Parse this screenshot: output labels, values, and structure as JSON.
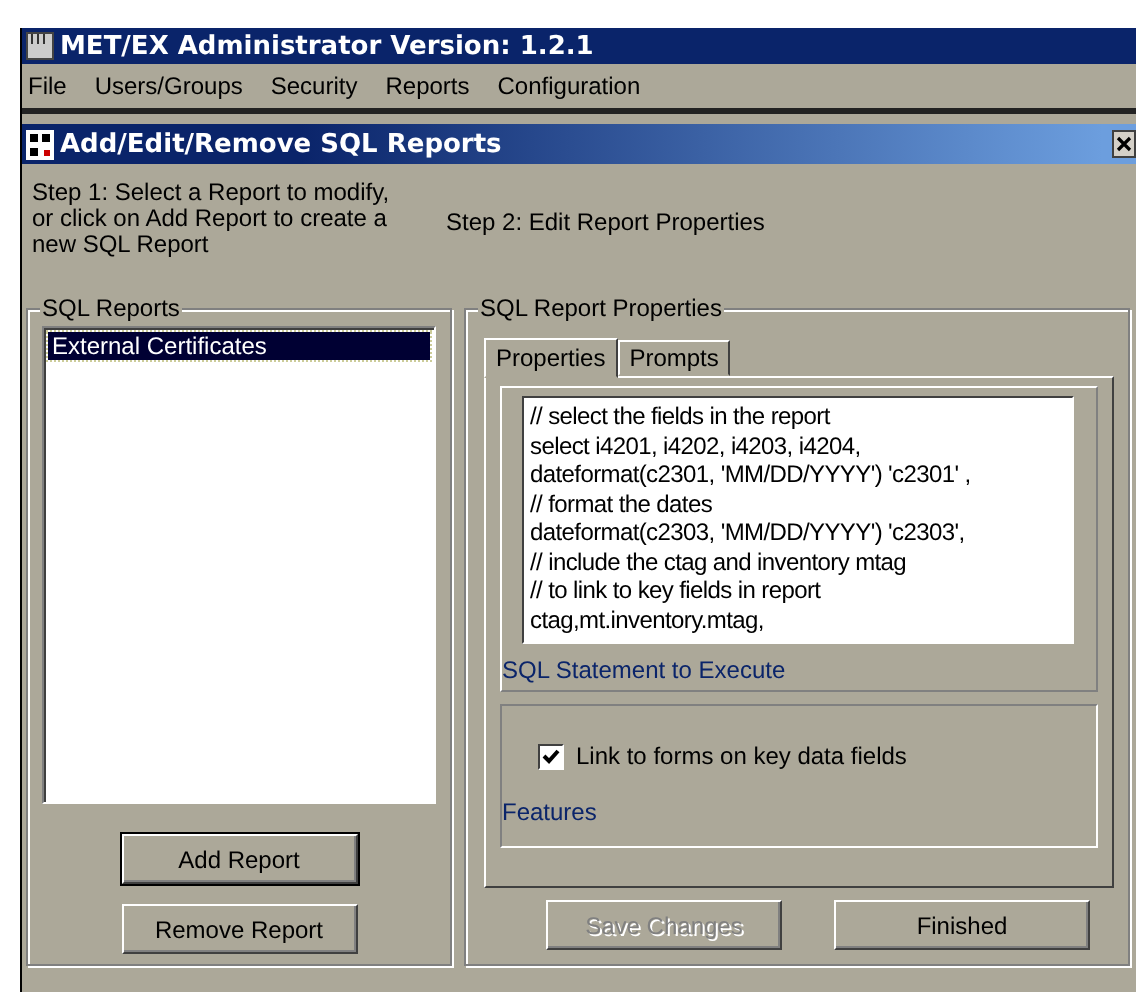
{
  "window": {
    "title": "MET/EX Administrator Version: 1.2.1"
  },
  "menu": [
    {
      "label": "File"
    },
    {
      "label": "Users/Groups"
    },
    {
      "label": "Security"
    },
    {
      "label": "Reports"
    },
    {
      "label": "Configuration"
    }
  ],
  "dialog": {
    "title": "Add/Edit/Remove SQL Reports",
    "step1": "Step 1: Select a Report to modify, or click on Add Report to create a new SQL Report",
    "step2": "Step 2: Edit Report Properties"
  },
  "reports_group": {
    "title": "SQL Reports",
    "items": [
      {
        "label": "External Certificates",
        "selected": true
      }
    ],
    "buttons": [
      {
        "label": "Add Report",
        "default": true
      },
      {
        "label": "Remove Report",
        "default": false
      }
    ]
  },
  "properties_group": {
    "title": "SQL Report Properties",
    "tabs": [
      {
        "label": "Properties",
        "selected": true
      },
      {
        "label": "Prompts",
        "selected": false
      }
    ],
    "sql_statement": [
      "// select the fields in the report",
      "select i4201, i4202, i4203, i4204,",
      "dateformat(c2301, 'MM/DD/YYYY') 'c2301' ,",
      "// format the dates",
      "dateformat(c2303, 'MM/DD/YYYY') 'c2303',",
      "// include the ctag and inventory mtag",
      "// to link to key fields in report",
      "ctag,mt.inventory.mtag,"
    ],
    "sql_caption": "SQL Statement to Execute",
    "options": [
      {
        "label": "Link to forms on key data fields",
        "checked": true
      }
    ],
    "features_caption": "Features"
  },
  "buttons": [
    {
      "label": "Save Changes",
      "disabled": true
    },
    {
      "label": "Finished",
      "disabled": false
    }
  ]
}
